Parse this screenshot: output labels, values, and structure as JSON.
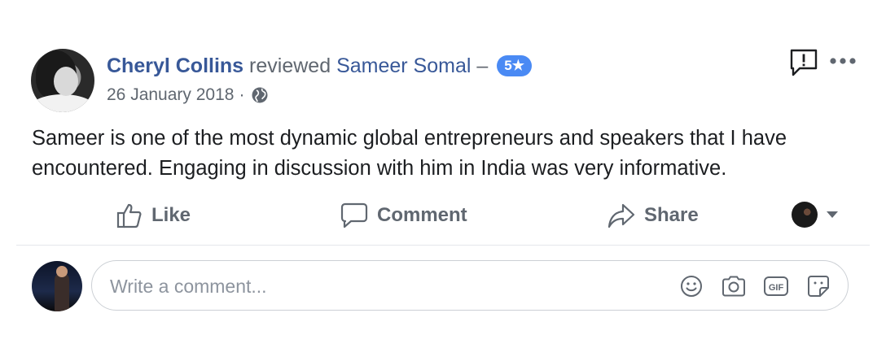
{
  "post": {
    "author": "Cheryl Collins",
    "verb": "reviewed",
    "target": "Sameer Somal",
    "separator": "–",
    "rating": "5★",
    "date": "26 January 2018",
    "dot": "·",
    "visibility_icon": "globe-icon",
    "text": "Sameer is one of the most dynamic global entrepreneurs and speakers that I have encountered. Engaging in discussion with him in India was very informative."
  },
  "header_icons": [
    "report-icon",
    "more-icon"
  ],
  "actions": {
    "like_label": "Like",
    "comment_label": "Comment",
    "share_label": "Share"
  },
  "comment": {
    "placeholder": "Write a comment...",
    "tools": [
      "emoji-icon",
      "camera-icon",
      "gif-icon",
      "sticker-icon"
    ]
  },
  "colors": {
    "link": "#385898",
    "muted": "#606770",
    "badge": "#4a8af4",
    "divider": "#e4e6eb"
  }
}
